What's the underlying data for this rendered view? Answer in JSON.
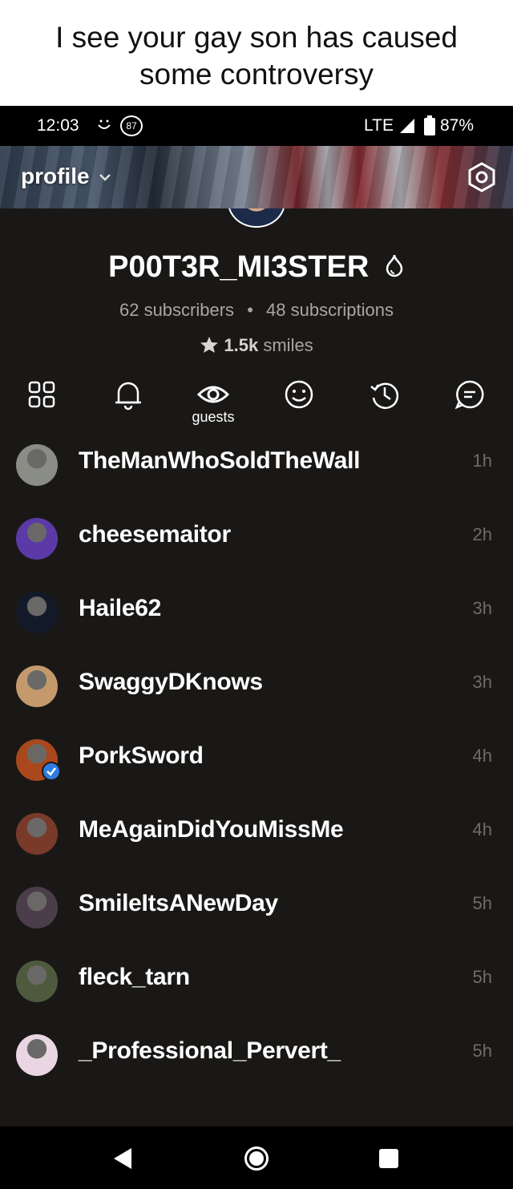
{
  "caption": "I see your gay son has caused\nsome controversy",
  "status_bar": {
    "time": "12:03",
    "notification_badge": "87",
    "network": "LTE",
    "battery": "87%"
  },
  "header": {
    "title": "profile"
  },
  "profile": {
    "username": "P00T3R_MI3STER",
    "subscribers": "62 subscribers",
    "separator": "•",
    "subscriptions": "48 subscriptions",
    "smiles_count": "1.5k",
    "smiles_label": "smiles"
  },
  "tabs": [
    {
      "icon": "grid-icon"
    },
    {
      "icon": "bell-icon"
    },
    {
      "icon": "eye-icon",
      "label": "guests"
    },
    {
      "icon": "smile-icon"
    },
    {
      "icon": "history-icon"
    },
    {
      "icon": "chat-icon"
    }
  ],
  "guests": [
    {
      "name": "TheManWhoSoldTheWall",
      "time": "1h",
      "avatar_color": "#8a8d86"
    },
    {
      "name": "cheesemaitor",
      "time": "2h",
      "avatar_color": "#5b3aa8"
    },
    {
      "name": "Haile62",
      "time": "3h",
      "avatar_color": "#121a2a"
    },
    {
      "name": "SwaggyDKnows",
      "time": "3h",
      "avatar_color": "#c49a6c"
    },
    {
      "name": "PorkSword",
      "time": "4h",
      "avatar_color": "#a9481c",
      "verified": true
    },
    {
      "name": "MeAgainDidYouMissMe",
      "time": "4h",
      "avatar_color": "#7a3a2a"
    },
    {
      "name": "SmileItsANewDay",
      "time": "5h",
      "avatar_color": "#4b3e4a"
    },
    {
      "name": "fleck_tarn",
      "time": "5h",
      "avatar_color": "#4e5a3e"
    },
    {
      "name": "_Professional_Pervert_",
      "time": "5h",
      "avatar_color": "#e9d6e2"
    }
  ]
}
